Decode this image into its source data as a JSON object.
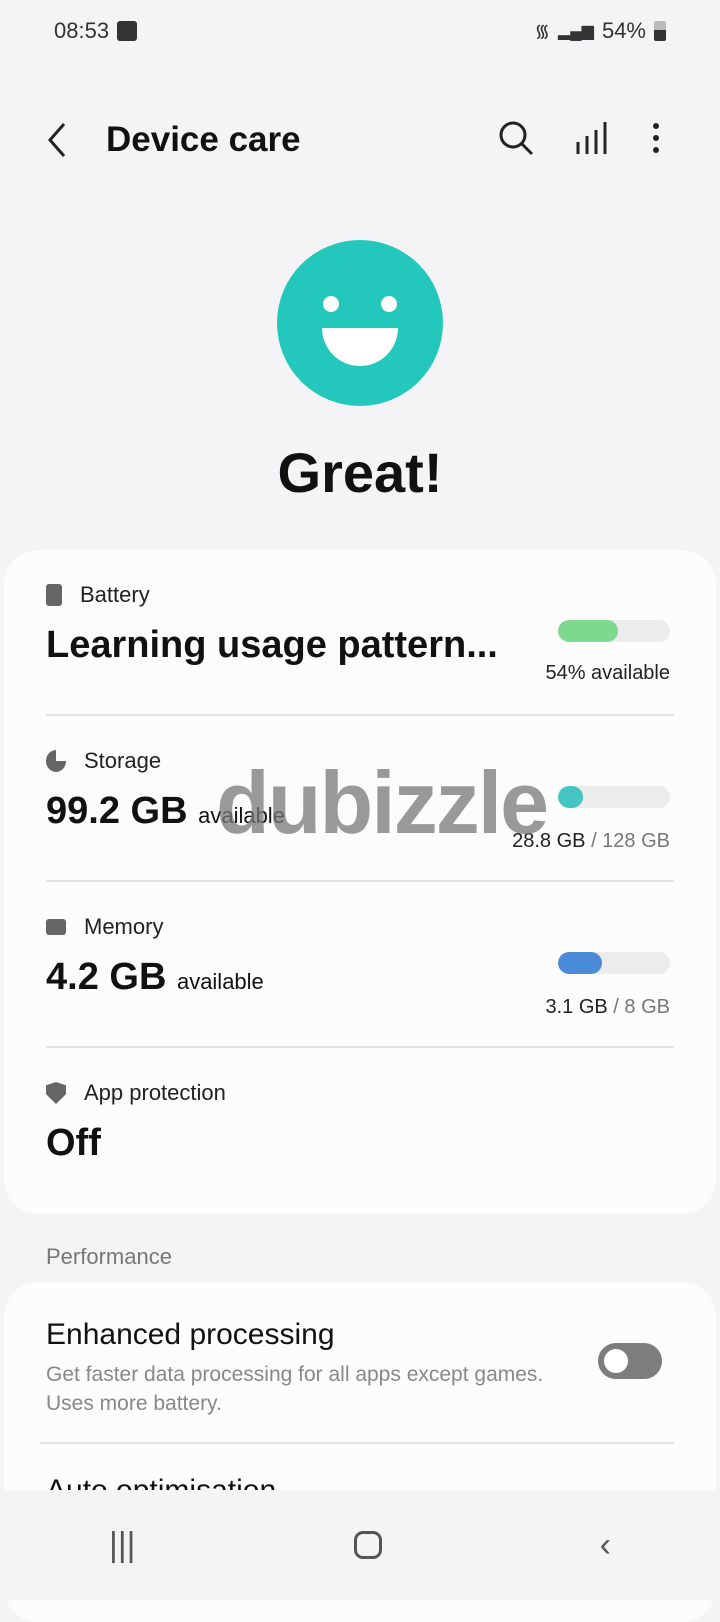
{
  "status_bar": {
    "time": "08:53",
    "battery": "54%"
  },
  "header": {
    "title": "Device care",
    "back_icon": "chevron-left-icon",
    "actions": [
      "search-icon",
      "stats-icon",
      "more-vert-icon"
    ]
  },
  "status": {
    "face": "smiley-face-icon",
    "label": "Great!",
    "color": "#24c7bb"
  },
  "battery": {
    "label": "Battery",
    "value": "Learning usage pattern...",
    "detail": "54% available",
    "level": 0.54,
    "color": "#7ed98e"
  },
  "storage": {
    "label": "Storage",
    "value": "99.2 GB",
    "suffix": "available",
    "used": "28.8 GB",
    "total": "/ 128 GB",
    "level": 0.225,
    "color": "#45c4c4"
  },
  "memory": {
    "label": "Memory",
    "value": "4.2 GB",
    "suffix": "available",
    "used": "3.1 GB",
    "total": "/ 8 GB",
    "level": 0.39,
    "color": "#4a8ad6"
  },
  "app_protection": {
    "label": "App protection",
    "value": "Off"
  },
  "performance": {
    "section": "Performance",
    "enhanced": {
      "title": "Enhanced processing",
      "desc": "Get faster data processing for all apps except games. Uses more battery.",
      "enabled": false
    },
    "auto": {
      "title": "Auto optimisation"
    }
  },
  "watermark": "dubizzle"
}
